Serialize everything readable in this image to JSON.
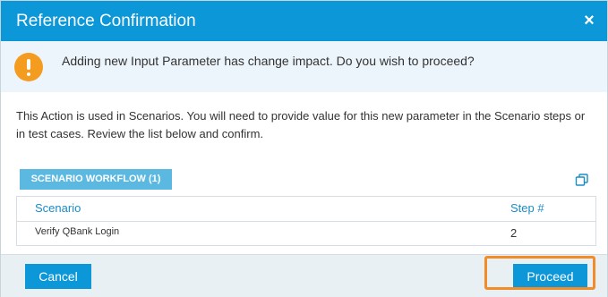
{
  "dialog": {
    "title": "Reference Confirmation",
    "close_glyph": "×",
    "close_icon": "close-icon"
  },
  "warning": {
    "icon": "warning-icon",
    "icon_color": "#f39c1f",
    "message": "Adding new Input Parameter has change impact. Do you wish to proceed?"
  },
  "info": {
    "text": "This Action is used in Scenarios. You will need to provide value for this new parameter in the Scenario steps or in test cases. Review the list below and confirm."
  },
  "tab": {
    "label": "SCENARIO WORKFLOW (1)"
  },
  "copy_icon": "copy-icon",
  "table": {
    "columns": [
      "Scenario",
      "Step #"
    ],
    "rows": [
      {
        "scenario": "Verify QBank Login",
        "step": "2"
      }
    ]
  },
  "footer": {
    "cancel_label": "Cancel",
    "proceed_label": "Proceed"
  },
  "colors": {
    "primary": "#0b97d8",
    "highlight": "#f28c28"
  }
}
